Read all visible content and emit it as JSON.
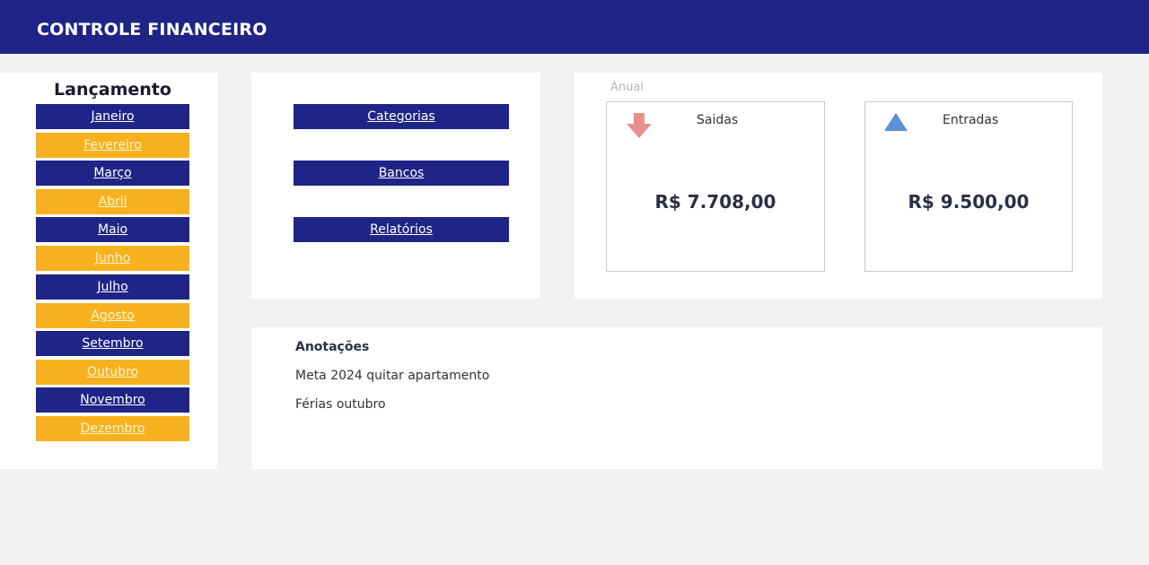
{
  "header": {
    "title": "CONTROLE FINANCEIRO"
  },
  "months": {
    "title": "Lançamento",
    "items": [
      {
        "label": "Janeiro",
        "style": "navy"
      },
      {
        "label": "Fevereiro",
        "style": "amber"
      },
      {
        "label": "Março",
        "style": "navy"
      },
      {
        "label": "Abril",
        "style": "amber"
      },
      {
        "label": "Maio",
        "style": "navy"
      },
      {
        "label": "Junho",
        "style": "amber"
      },
      {
        "label": "Julho",
        "style": "navy"
      },
      {
        "label": "Agosto",
        "style": "amber"
      },
      {
        "label": "Setembro",
        "style": "navy"
      },
      {
        "label": "Outubro",
        "style": "amber"
      },
      {
        "label": "Novembro",
        "style": "navy"
      },
      {
        "label": "Dezembro",
        "style": "amber"
      }
    ]
  },
  "links": {
    "categorias": "Categorias",
    "bancos": "Bancos",
    "relatorios": "Relatórios"
  },
  "annual": {
    "label": "Anual",
    "saidas": {
      "label": "Saidas",
      "value": "R$ 7.708,00",
      "icon": "arrow-down-icon",
      "color": "#e98f8f"
    },
    "entradas": {
      "label": "Entradas",
      "value": "R$ 9.500,00",
      "icon": "triangle-up-icon",
      "color": "#5b8fd6"
    }
  },
  "notes": {
    "title": "Anotações",
    "lines": [
      "Meta 2024 quitar apartamento",
      "Férias outubro"
    ]
  },
  "colors": {
    "primary": "#1f2586",
    "accent": "#f7b11e",
    "background": "#f2f2f2"
  }
}
